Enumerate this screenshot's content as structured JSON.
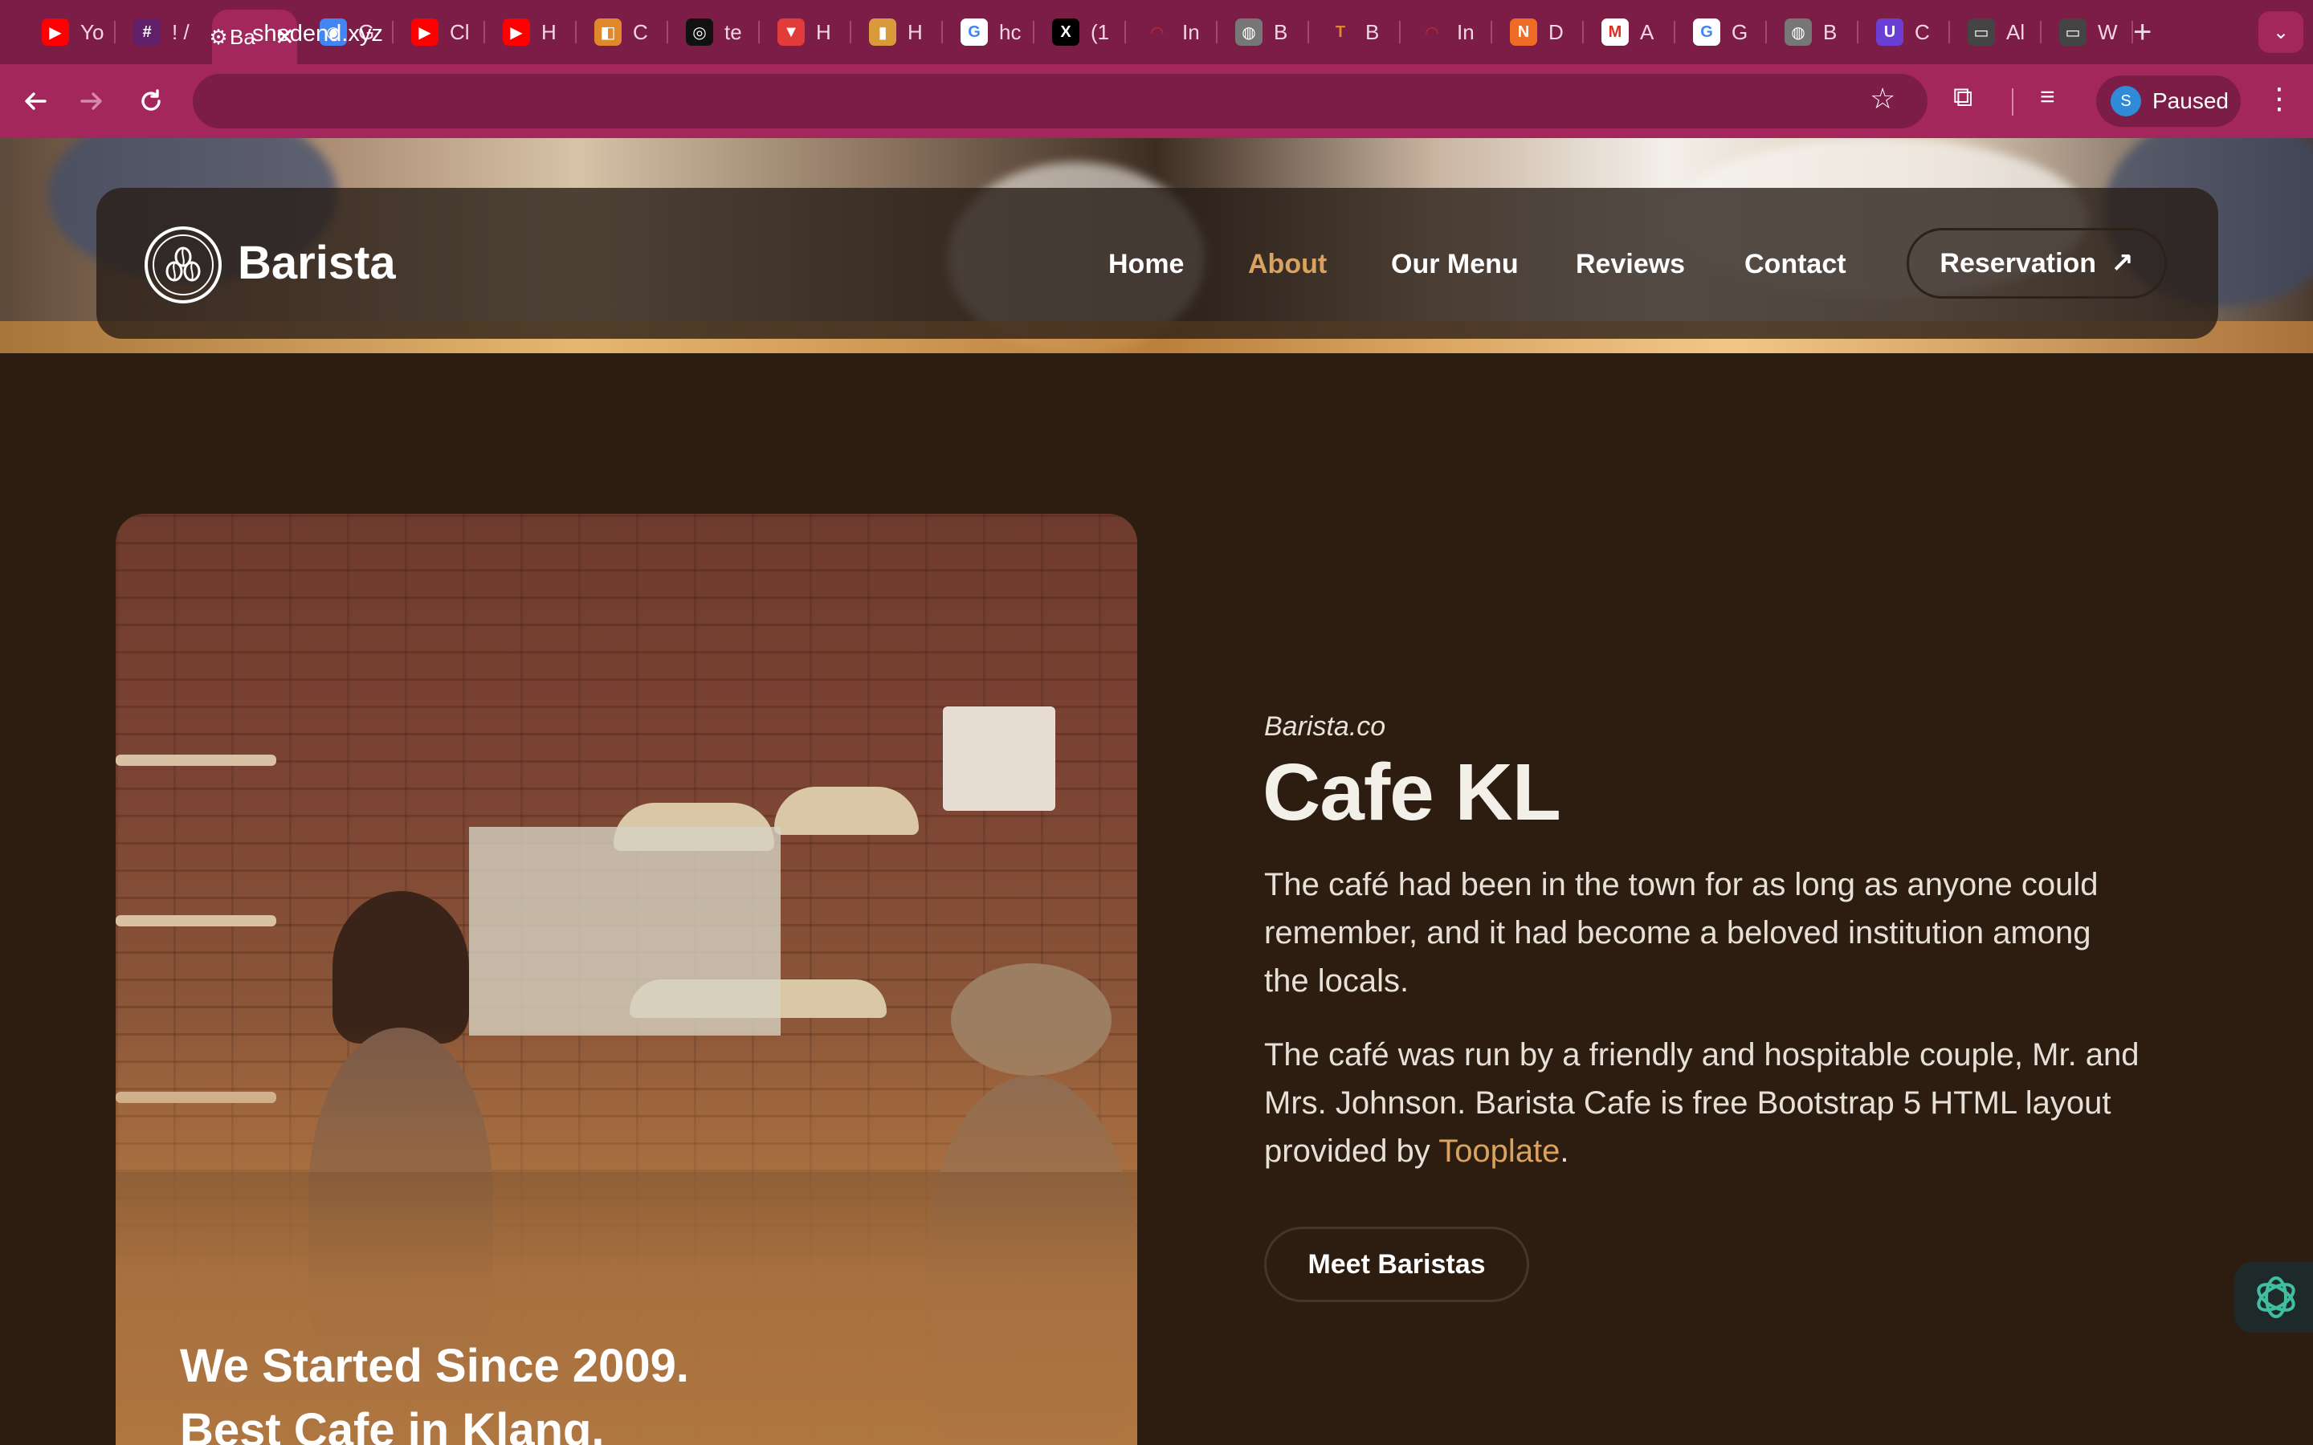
{
  "browser": {
    "tabs": [
      {
        "label": "Yo",
        "color": "#ff0000",
        "glyph": "▶"
      },
      {
        "label": "! /",
        "color": "#611f69",
        "glyph": "#"
      },
      {
        "label": "Ba",
        "color": "#7c1d47",
        "glyph": "",
        "close": "✕"
      },
      {
        "label": "G",
        "color": "#4285f4",
        "glyph": "◉"
      },
      {
        "label": "Cl",
        "color": "#ff0000",
        "glyph": "▶"
      },
      {
        "label": "H",
        "color": "#ff0000",
        "glyph": "▶"
      },
      {
        "label": "C",
        "color": "#e0892c",
        "glyph": "◧"
      },
      {
        "label": "te",
        "color": "#111111",
        "glyph": "◎"
      },
      {
        "label": "H",
        "color": "#e23b3b",
        "glyph": "▼"
      },
      {
        "label": "H",
        "color": "#d99a3b",
        "glyph": "▮"
      },
      {
        "label": "hc",
        "color": "#ffffff",
        "glyph": "G"
      },
      {
        "label": "(1",
        "color": "#000000",
        "glyph": "X"
      },
      {
        "label": "In",
        "color": "#c82a2a",
        "glyph": "◠"
      },
      {
        "label": "B",
        "color": "#777777",
        "glyph": "◍"
      },
      {
        "label": "B",
        "color": "#e0892c",
        "glyph": "T"
      },
      {
        "label": "In",
        "color": "#c82a2a",
        "glyph": "◠"
      },
      {
        "label": "D",
        "color": "#f06b26",
        "glyph": "N"
      },
      {
        "label": "A",
        "color": "#ffffff",
        "glyph": "M"
      },
      {
        "label": "G",
        "color": "#ffffff",
        "glyph": "G"
      },
      {
        "label": "B",
        "color": "#777777",
        "glyph": "◍"
      },
      {
        "label": "C",
        "color": "#6b3fd6",
        "glyph": "U"
      },
      {
        "label": "Al",
        "color": "#444444",
        "glyph": "▭"
      },
      {
        "label": "W",
        "color": "#444444",
        "glyph": "▭"
      }
    ],
    "new_tab": "+",
    "tab_menu": "⌄",
    "url": "shedend.xyz",
    "profile_initial": "S",
    "profile_status": "Paused"
  },
  "nav": {
    "brand": "Barista",
    "links": [
      "Home",
      "About",
      "Our Menu",
      "Reviews",
      "Contact"
    ],
    "active_link": "About",
    "reservation": "Reservation",
    "reservation_arrow": "↗"
  },
  "about": {
    "photo_caption_line1": "We Started Since 2009.",
    "photo_caption_line2": "Best Cafe in Klang.",
    "eyebrow": "Barista.co",
    "title": "Cafe KL",
    "para1": "The café had been in the town for as long as anyone could remember, and it had become a beloved institution among the locals.",
    "para2_text": "The café was run by a friendly and hospitable couple, Mr. and Mrs. Johnson. Barista Cafe is free Bootstrap 5 HTML layout provided by ",
    "para2_link": "Tooplate",
    "para2_end": ".",
    "cta": "Meet Baristas"
  },
  "colors": {
    "accent": "#d9a35f",
    "page_bg": "#2c1d10",
    "chrome": "#a3275d"
  }
}
